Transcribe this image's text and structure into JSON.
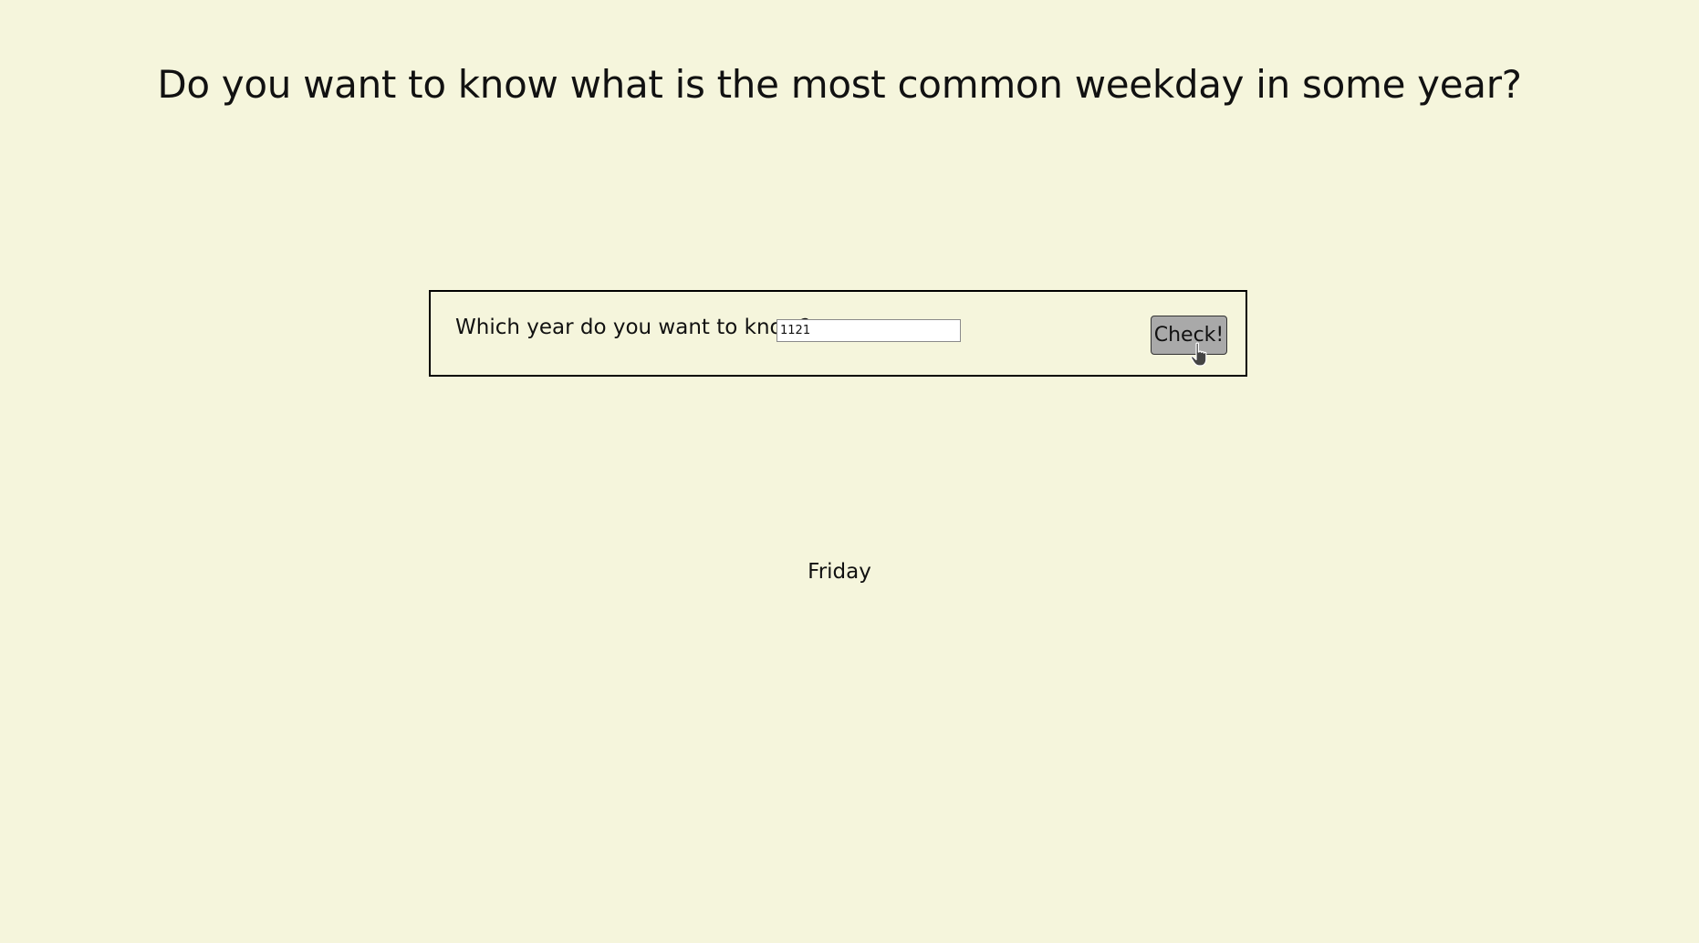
{
  "header": {
    "title": "Do you want to know what is the most common weekday in some year?"
  },
  "form": {
    "question_label": "Which year do you want to know?",
    "year_value": "1121",
    "check_button_label": "Check!"
  },
  "result": {
    "text": "Friday"
  },
  "icons": {
    "cursor": "hand-pointer-cursor-icon"
  },
  "colors": {
    "background": "#f5f5dc",
    "button": "#a9a9a9",
    "border": "#000000"
  }
}
